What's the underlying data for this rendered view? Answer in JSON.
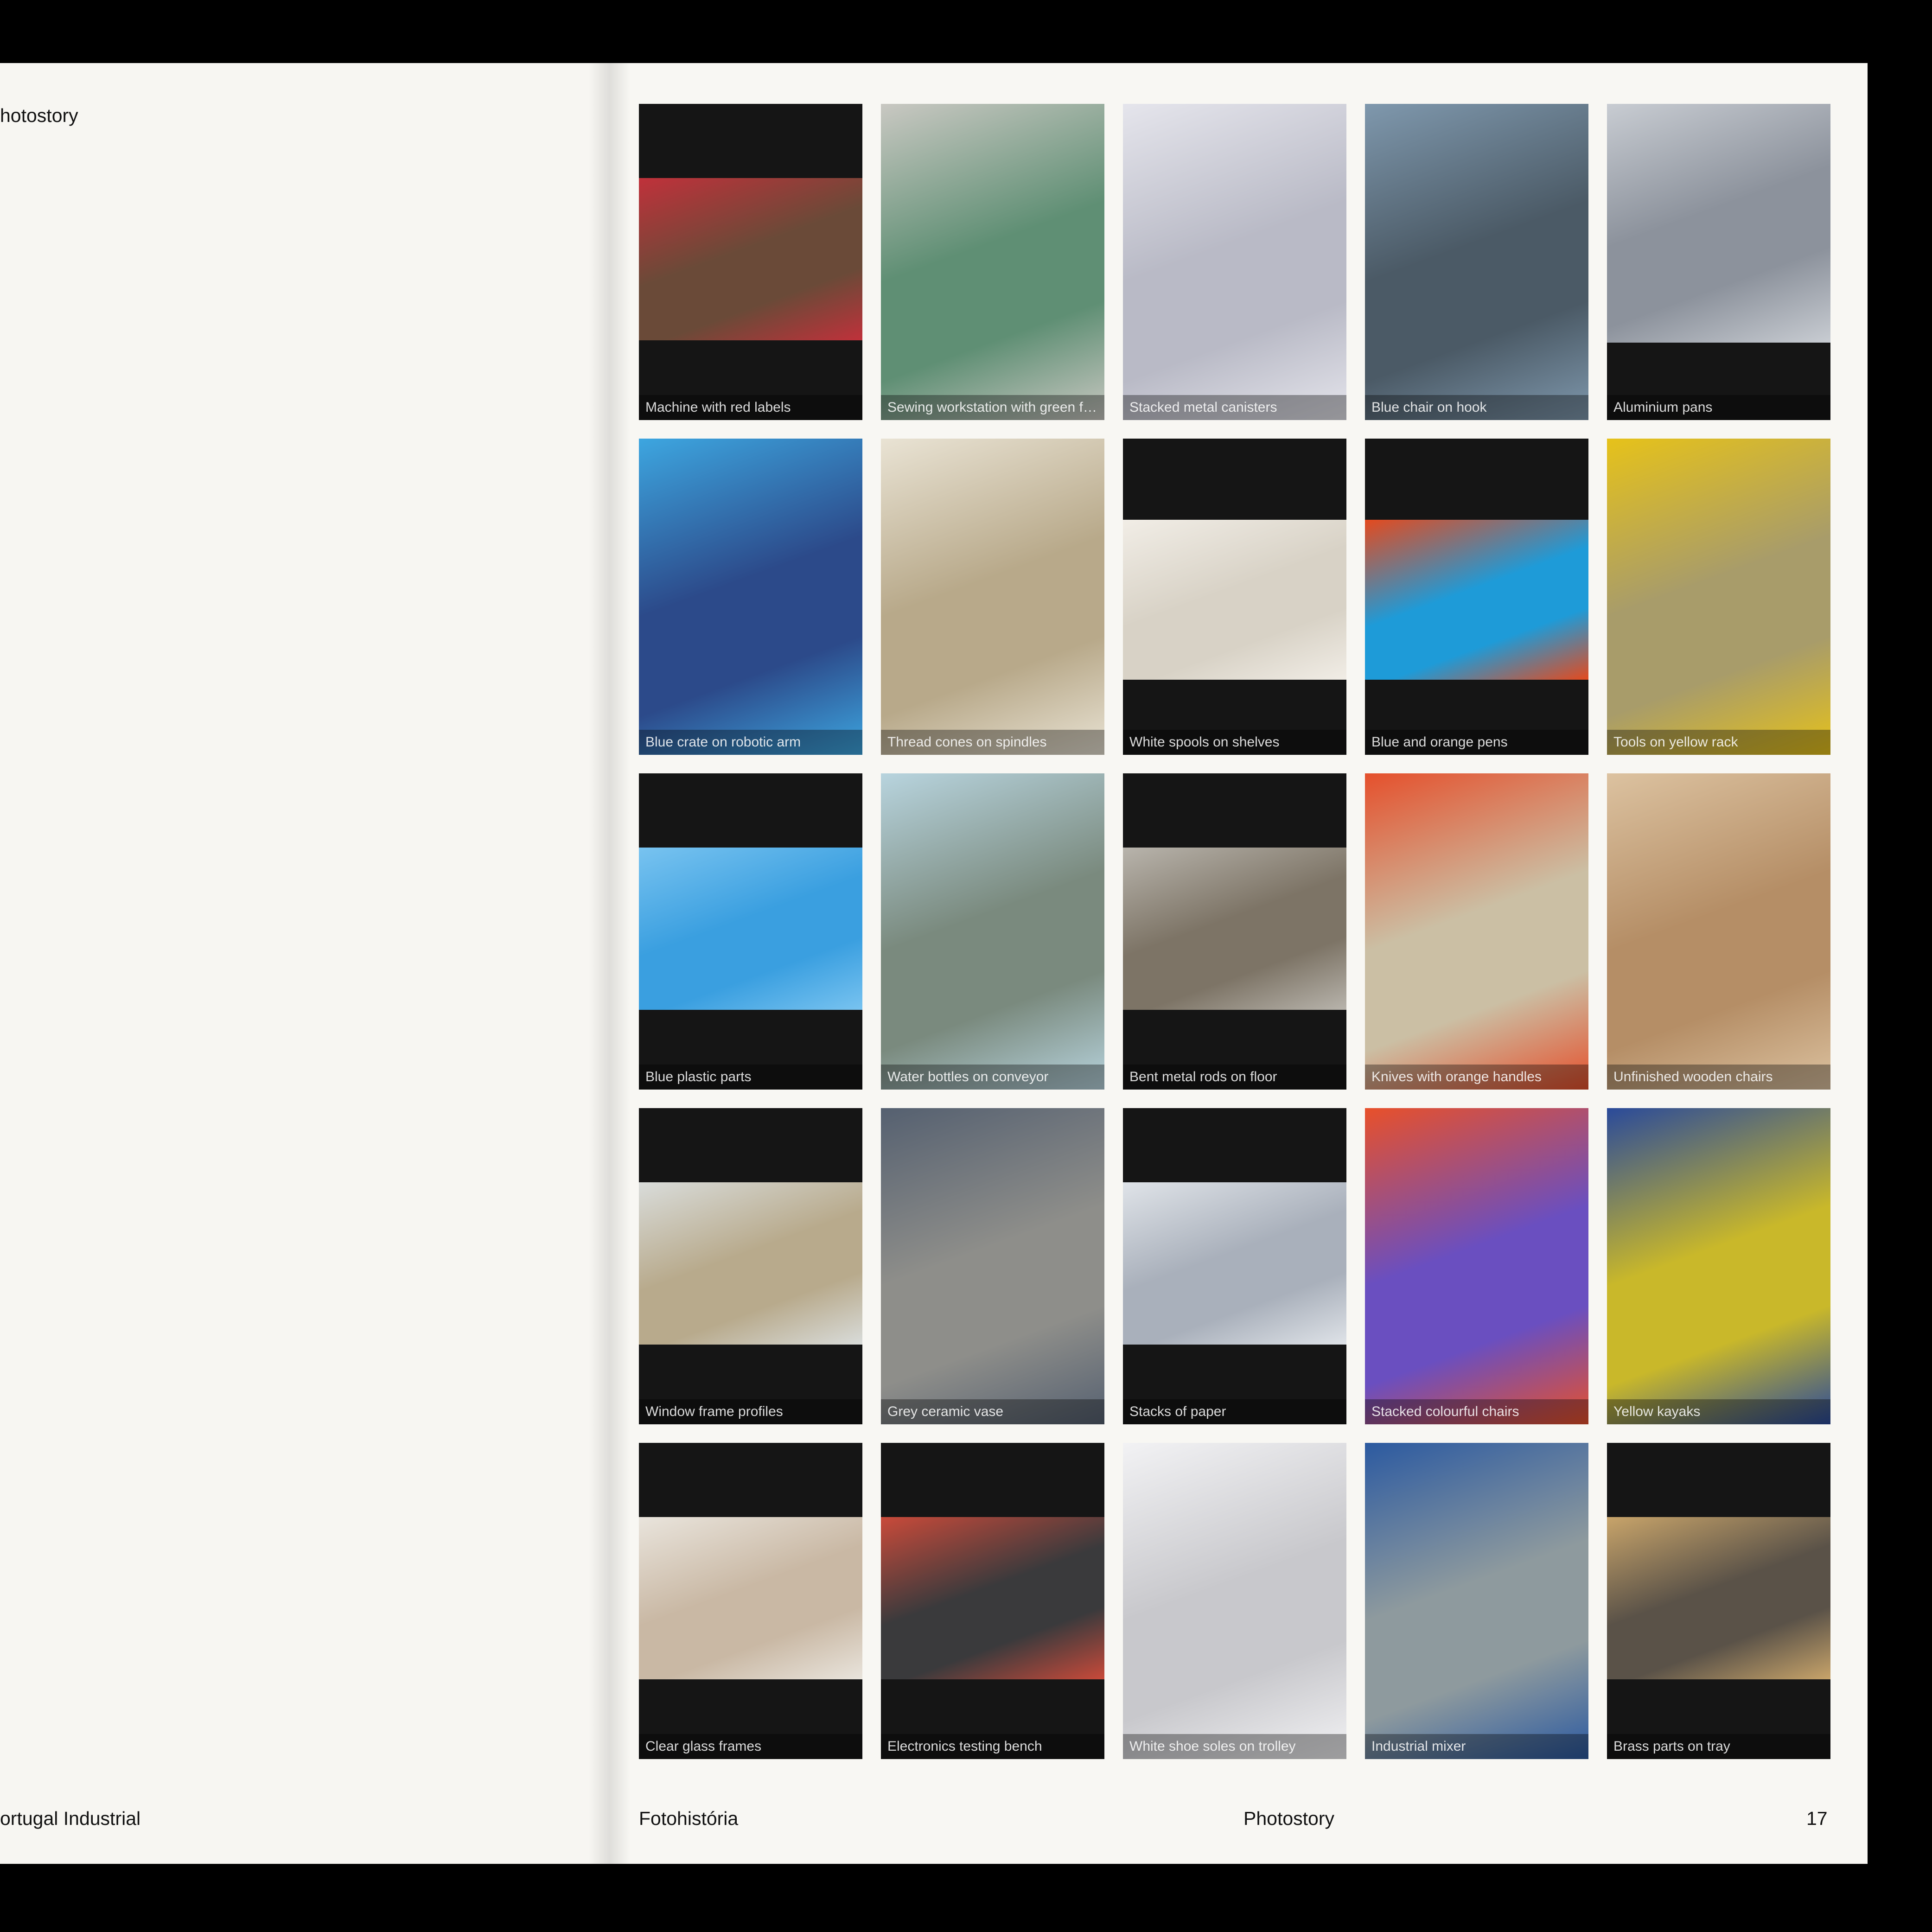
{
  "left_page": {
    "header": "hotostory",
    "footer": "ortugal Industrial"
  },
  "right_page": {
    "footer_left": "Fotohistória",
    "footer_center": "Photostory",
    "page_number": "17"
  },
  "photos": [
    {
      "caption": "Machine with red labels",
      "layout": "mid",
      "color": "#6a4a38",
      "accent": "#c0313a"
    },
    {
      "caption": "Sewing workstation with green forms",
      "layout": "full",
      "color": "#5f8f74",
      "accent": "#c9c8c2"
    },
    {
      "caption": "Stacked metal canisters",
      "layout": "full",
      "color": "#b9bac6",
      "accent": "#e5e5ec"
    },
    {
      "caption": "Blue chair on hook",
      "layout": "full",
      "color": "#4b5a66",
      "accent": "#7f98ad"
    },
    {
      "caption": "Aluminium pans",
      "layout": "top",
      "color": "#8c929c",
      "accent": "#c8ccd2"
    },
    {
      "caption": "Blue crate on robotic arm",
      "layout": "full",
      "color": "#2c4a8a",
      "accent": "#3da6e0"
    },
    {
      "caption": "Thread cones on spindles",
      "layout": "full",
      "color": "#b8a98a",
      "accent": "#e9e3d4"
    },
    {
      "caption": "White spools on shelves",
      "layout": "hi",
      "color": "#d8d2c6",
      "accent": "#f1ede6"
    },
    {
      "caption": "Blue and orange pens",
      "layout": "hi",
      "color": "#1e9bd8",
      "accent": "#e44a1e"
    },
    {
      "caption": "Tools on yellow rack",
      "layout": "full",
      "color": "#a89c6a",
      "accent": "#e6c21a"
    },
    {
      "caption": "Blue plastic parts",
      "layout": "mid",
      "color": "#3a9fe0",
      "accent": "#78c3f0"
    },
    {
      "caption": "Water bottles on conveyor",
      "layout": "full",
      "color": "#7a8a7e",
      "accent": "#b8d4de"
    },
    {
      "caption": "Bent metal rods on floor",
      "layout": "mid",
      "color": "#7d7466",
      "accent": "#b8b4ac"
    },
    {
      "caption": "Knives with orange handles",
      "layout": "full",
      "color": "#cbbfa4",
      "accent": "#e5502c"
    },
    {
      "caption": "Unfinished wooden chairs",
      "layout": "full",
      "color": "#b58e66",
      "accent": "#dcc2a0"
    },
    {
      "caption": "Window frame profiles",
      "layout": "mid",
      "color": "#b8aa8c",
      "accent": "#d9dcda"
    },
    {
      "caption": "Grey ceramic vase",
      "layout": "full",
      "color": "#8e8e8a",
      "accent": "#556070"
    },
    {
      "caption": "Stacks of paper",
      "layout": "mid",
      "color": "#a9b0bb",
      "accent": "#dfe3e8"
    },
    {
      "caption": "Stacked colourful chairs",
      "layout": "full",
      "color": "#6a4fc0",
      "accent": "#e8502a"
    },
    {
      "caption": "Yellow kayaks",
      "layout": "full",
      "color": "#c9b82a",
      "accent": "#2a4a9a"
    },
    {
      "caption": "Clear glass frames",
      "layout": "mid",
      "color": "#c9b8a4",
      "accent": "#e9e4dc"
    },
    {
      "caption": "Electronics testing bench",
      "layout": "mid",
      "color": "#3a3a3c",
      "accent": "#c94a3a"
    },
    {
      "caption": "White shoe soles on trolley",
      "layout": "full",
      "color": "#c8c8cc",
      "accent": "#f2f2f4"
    },
    {
      "caption": "Industrial mixer",
      "layout": "full",
      "color": "#8e9a9e",
      "accent": "#2c5aa0"
    },
    {
      "caption": "Brass parts on tray",
      "layout": "mid",
      "color": "#5a5248",
      "accent": "#c8a46a"
    }
  ]
}
